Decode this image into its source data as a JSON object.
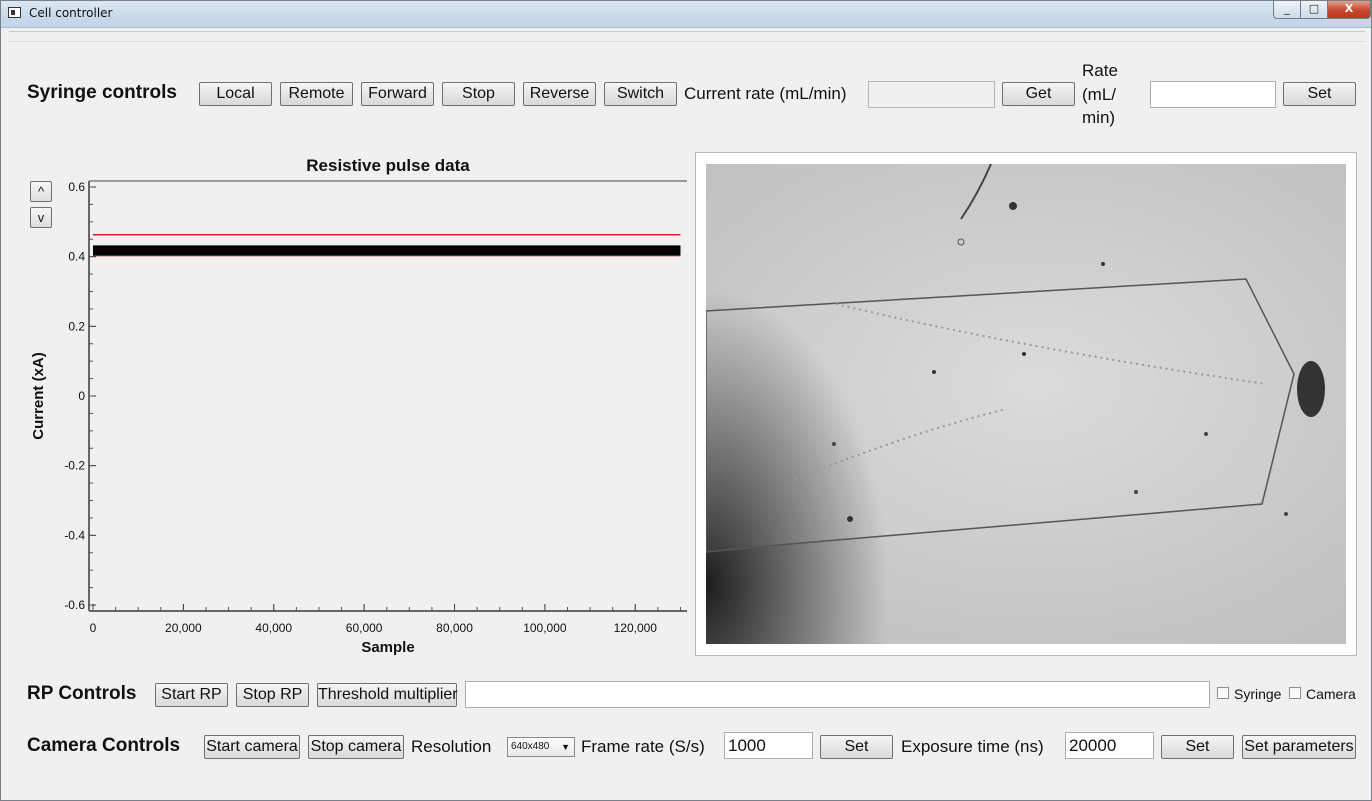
{
  "window": {
    "title": "Cell controller",
    "min_glyph": "_",
    "max_glyph": "□",
    "close_glyph": "X"
  },
  "syringe": {
    "title": "Syringe controls",
    "buttons": {
      "local": "Local",
      "remote": "Remote",
      "forward": "Forward",
      "stop": "Stop",
      "reverse": "Reverse",
      "switch": "Switch"
    },
    "current_rate_label": "Current rate (mL/min)",
    "current_rate_value": "",
    "get_label": "Get",
    "rate_label_1": "Rate",
    "rate_label_2": "(mL/",
    "rate_label_3": "min)",
    "rate_value": "",
    "set_label": "Set"
  },
  "plot": {
    "up_label": "^",
    "down_label": "v"
  },
  "chart_data": {
    "type": "line",
    "title": "Resistive pulse data",
    "xlabel": "Sample",
    "ylabel": "Current (xA)",
    "xlim": [
      0,
      131000
    ],
    "ylim": [
      -0.6,
      0.6
    ],
    "x_ticks": [
      0,
      20000,
      40000,
      60000,
      80000,
      100000,
      120000
    ],
    "x_tick_labels": [
      "0",
      "20,000",
      "40,000",
      "60,000",
      "80,000",
      "100,000",
      "120,000"
    ],
    "y_ticks": [
      0.6,
      0.4,
      0.2,
      0,
      -0.2,
      -0.4,
      -0.6
    ],
    "y_tick_labels": [
      "0.6",
      "0.4",
      "0.2",
      "0",
      "-0.2",
      "-0.4",
      "-0.6"
    ],
    "series": [
      {
        "x": [
          0,
          130000
        ],
        "y": [
          0.418,
          0.418
        ],
        "color": "#000000"
      },
      {
        "x": [
          0,
          130000
        ],
        "y": [
          0.463,
          0.463
        ],
        "color": "#c00000"
      },
      {
        "x": [
          0,
          130000
        ],
        "y": [
          0.403,
          0.403
        ],
        "color": "#c00000"
      }
    ],
    "grid": false
  },
  "rp": {
    "title": "RP Controls",
    "start_label": "Start RP",
    "stop_label": "Stop RP",
    "threshold_label": "Threshold multiplier",
    "threshold_value": "",
    "syringe_chk_label": "Syringe",
    "camera_chk_label": "Camera"
  },
  "camera": {
    "title": "Camera Controls",
    "start_label": "Start camera",
    "stop_label": "Stop camera",
    "resolution_label": "Resolution",
    "resolution_value": "640x480",
    "frame_rate_label": "Frame rate (S/s)",
    "frame_rate_value": "1000",
    "set_label": "Set",
    "exposure_label": "Exposure time (ns)",
    "exposure_value": "20000",
    "set_parameters_label": "Set parameters"
  }
}
